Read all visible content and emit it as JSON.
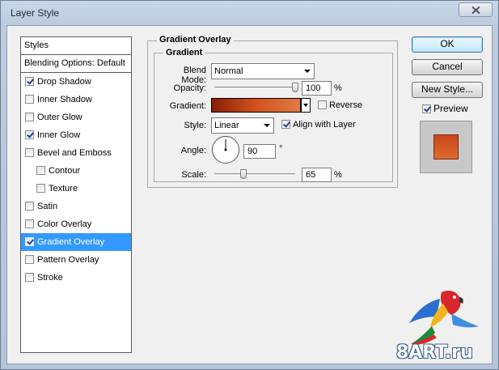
{
  "window": {
    "title": "Layer Style"
  },
  "styles_list": {
    "header": "Styles",
    "blending_options": "Blending Options: Default",
    "items": [
      {
        "label": "Drop Shadow",
        "checked": true
      },
      {
        "label": "Inner Shadow",
        "checked": false
      },
      {
        "label": "Outer Glow",
        "checked": false
      },
      {
        "label": "Inner Glow",
        "checked": true
      },
      {
        "label": "Bevel and Emboss",
        "checked": false
      },
      {
        "label": "Contour",
        "checked": false
      },
      {
        "label": "Texture",
        "checked": false
      },
      {
        "label": "Satin",
        "checked": false
      },
      {
        "label": "Color Overlay",
        "checked": false
      },
      {
        "label": "Gradient Overlay",
        "checked": true,
        "selected": true
      },
      {
        "label": "Pattern Overlay",
        "checked": false
      },
      {
        "label": "Stroke",
        "checked": false
      }
    ]
  },
  "panel": {
    "title": "Gradient Overlay",
    "group": "Gradient",
    "blend_mode_label": "Blend Mode:",
    "blend_mode_value": "Normal",
    "opacity_label": "Opacity:",
    "opacity_value": "100",
    "opacity_unit": "%",
    "opacity_fraction": 1.0,
    "gradient_label": "Gradient:",
    "gradient_colors": [
      "#8a1f05",
      "#d2521e",
      "#e07a45"
    ],
    "reverse_label": "Reverse",
    "reverse_checked": false,
    "style_label": "Style:",
    "style_value": "Linear",
    "align_label": "Align with Layer",
    "align_checked": true,
    "angle_label": "Angle:",
    "angle_value": "90",
    "angle_unit": "°",
    "scale_label": "Scale:",
    "scale_value": "65",
    "scale_unit": "%",
    "scale_fraction": 0.65
  },
  "buttons": {
    "ok": "OK",
    "cancel": "Cancel",
    "new_style": "New Style...",
    "preview_label": "Preview",
    "preview_checked": true
  },
  "watermark": {
    "text": "8ART.ru"
  }
}
